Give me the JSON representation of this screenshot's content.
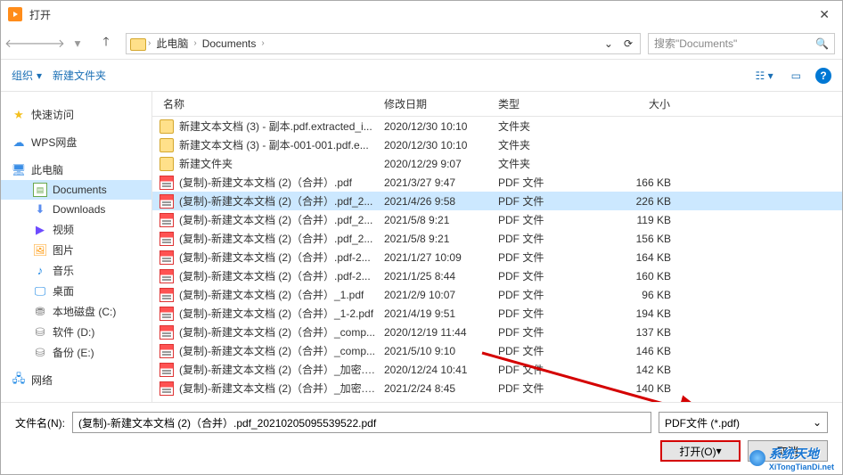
{
  "title": "打开",
  "breadcrumb": {
    "root": "此电脑",
    "folder": "Documents"
  },
  "search_placeholder": "搜索\"Documents\"",
  "toolbar": {
    "organize": "组织",
    "newfolder": "新建文件夹"
  },
  "sidebar": {
    "quick": "快速访问",
    "wps": "WPS网盘",
    "pc": "此电脑",
    "documents": "Documents",
    "downloads": "Downloads",
    "videos": "视频",
    "pictures": "图片",
    "music": "音乐",
    "desktop": "桌面",
    "drive_c": "本地磁盘 (C:)",
    "drive_d": "软件 (D:)",
    "drive_e": "备份 (E:)",
    "network": "网络"
  },
  "columns": {
    "name": "名称",
    "date": "修改日期",
    "type": "类型",
    "size": "大小"
  },
  "types": {
    "folder": "文件夹",
    "pdf": "PDF 文件"
  },
  "files": [
    {
      "icon": "folder",
      "name": "新建文本文档 (3) - 副本.pdf.extracted_i...",
      "date": "2020/12/30 10:10",
      "type": "folder",
      "size": ""
    },
    {
      "icon": "folder",
      "name": "新建文本文档 (3) - 副本-001-001.pdf.e...",
      "date": "2020/12/30 10:10",
      "type": "folder",
      "size": ""
    },
    {
      "icon": "folder",
      "name": "新建文件夹",
      "date": "2020/12/29 9:07",
      "type": "folder",
      "size": ""
    },
    {
      "icon": "pdf",
      "name": "(复制)-新建文本文档 (2)（合并）.pdf",
      "date": "2021/3/27 9:47",
      "type": "pdf",
      "size": "166 KB"
    },
    {
      "icon": "pdf",
      "name": "(复制)-新建文本文档 (2)（合并）.pdf_2...",
      "date": "2021/4/26 9:58",
      "type": "pdf",
      "size": "226 KB",
      "selected": true
    },
    {
      "icon": "pdf",
      "name": "(复制)-新建文本文档 (2)（合并）.pdf_2...",
      "date": "2021/5/8 9:21",
      "type": "pdf",
      "size": "119 KB"
    },
    {
      "icon": "pdf",
      "name": "(复制)-新建文本文档 (2)（合并）.pdf_2...",
      "date": "2021/5/8 9:21",
      "type": "pdf",
      "size": "156 KB"
    },
    {
      "icon": "pdf",
      "name": "(复制)-新建文本文档 (2)（合并）.pdf-2...",
      "date": "2021/1/27 10:09",
      "type": "pdf",
      "size": "164 KB"
    },
    {
      "icon": "pdf",
      "name": "(复制)-新建文本文档 (2)（合并）.pdf-2...",
      "date": "2021/1/25 8:44",
      "type": "pdf",
      "size": "160 KB"
    },
    {
      "icon": "pdf",
      "name": "(复制)-新建文本文档 (2)（合并）_1.pdf",
      "date": "2021/2/9 10:07",
      "type": "pdf",
      "size": "96 KB"
    },
    {
      "icon": "pdf",
      "name": "(复制)-新建文本文档 (2)（合并）_1-2.pdf",
      "date": "2021/4/19 9:51",
      "type": "pdf",
      "size": "194 KB"
    },
    {
      "icon": "pdf",
      "name": "(复制)-新建文本文档 (2)（合并）_comp...",
      "date": "2020/12/19 11:44",
      "type": "pdf",
      "size": "137 KB"
    },
    {
      "icon": "pdf",
      "name": "(复制)-新建文本文档 (2)（合并）_comp...",
      "date": "2021/5/10 9:10",
      "type": "pdf",
      "size": "146 KB"
    },
    {
      "icon": "pdf",
      "name": "(复制)-新建文本文档 (2)（合并）_加密.p...",
      "date": "2020/12/24 10:41",
      "type": "pdf",
      "size": "142 KB"
    },
    {
      "icon": "pdf",
      "name": "(复制)-新建文本文档 (2)（合并）_加密.p...",
      "date": "2021/2/24 8:45",
      "type": "pdf",
      "size": "140 KB"
    }
  ],
  "bottom": {
    "filename_label": "文件名(N):",
    "filename_value": "(复制)-新建文本文档 (2)（合并）.pdf_20210205095539522.pdf",
    "filter": "PDF文件 (*.pdf)",
    "open": "打开(O)",
    "cancel": "取消"
  },
  "watermark": {
    "text": "系统天地",
    "url": "XiTongTianDi.net"
  }
}
